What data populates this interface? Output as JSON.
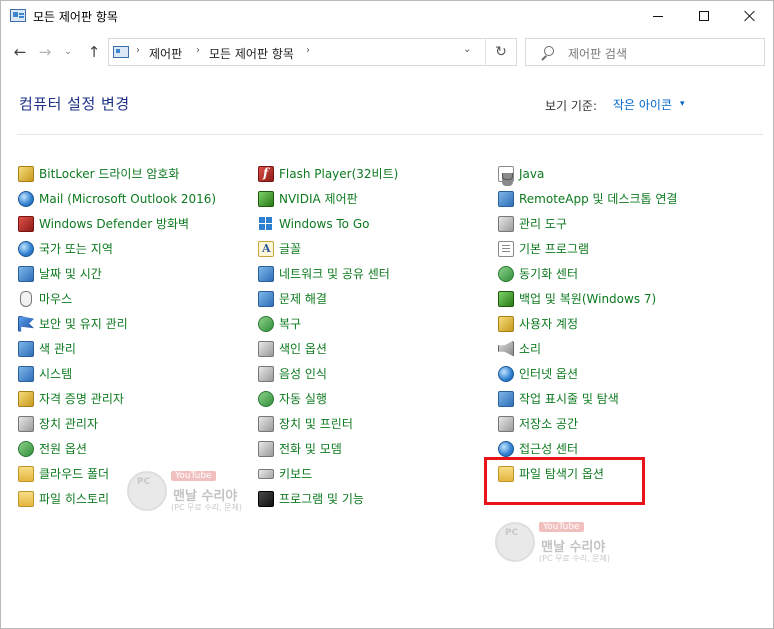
{
  "window": {
    "title": "모든 제어판 항목"
  },
  "nav": {
    "back_glyph": "←",
    "forward_glyph": "→",
    "recent_glyph": "⌄",
    "up_glyph": "↑",
    "breadcrumb": [
      "제어판",
      "모든 제어판 항목"
    ],
    "crumb_separator": "›",
    "dropdown_glyph": "⌄",
    "refresh_glyph": "↻",
    "search_placeholder": "제어판 검색"
  },
  "header": {
    "title": "컴퓨터 설정 변경",
    "view_label": "보기 기준:",
    "view_value": "작은 아이콘",
    "view_caret": "▾"
  },
  "columns": [
    [
      {
        "label": "BitLocker 드라이브 암호화",
        "icon": "bitlocker-icon"
      },
      {
        "label": "Mail (Microsoft Outlook 2016)",
        "icon": "mail-icon"
      },
      {
        "label": "Windows Defender 방화벽",
        "icon": "firewall-icon"
      },
      {
        "label": "국가 또는 지역",
        "icon": "region-globe-icon"
      },
      {
        "label": "날짜 및 시간",
        "icon": "date-time-icon"
      },
      {
        "label": "마우스",
        "icon": "mouse-icon"
      },
      {
        "label": "보안 및 유지 관리",
        "icon": "security-flag-icon"
      },
      {
        "label": "색 관리",
        "icon": "color-management-icon"
      },
      {
        "label": "시스템",
        "icon": "system-icon"
      },
      {
        "label": "자격 증명 관리자",
        "icon": "credential-manager-icon"
      },
      {
        "label": "장치 관리자",
        "icon": "device-manager-icon"
      },
      {
        "label": "전원 옵션",
        "icon": "power-options-icon"
      },
      {
        "label": "클라우드 폴더",
        "icon": "cloud-folder-icon"
      },
      {
        "label": "파일 히스토리",
        "icon": "file-history-icon"
      }
    ],
    [
      {
        "label": "Flash Player(32비트)",
        "icon": "flash-player-icon"
      },
      {
        "label": "NVIDIA 제어판",
        "icon": "nvidia-icon"
      },
      {
        "label": "Windows To Go",
        "icon": "windows-to-go-icon"
      },
      {
        "label": "글꼴",
        "icon": "fonts-icon"
      },
      {
        "label": "네트워크 및 공유 센터",
        "icon": "network-icon"
      },
      {
        "label": "문제 해결",
        "icon": "troubleshoot-icon"
      },
      {
        "label": "복구",
        "icon": "recovery-icon"
      },
      {
        "label": "색인 옵션",
        "icon": "indexing-icon"
      },
      {
        "label": "음성 인식",
        "icon": "speech-recognition-icon"
      },
      {
        "label": "자동 실행",
        "icon": "autoplay-icon"
      },
      {
        "label": "장치 및 프린터",
        "icon": "devices-printers-icon"
      },
      {
        "label": "전화 및 모뎀",
        "icon": "phone-modem-icon"
      },
      {
        "label": "키보드",
        "icon": "keyboard-icon"
      },
      {
        "label": "프로그램 및 기능",
        "icon": "programs-features-icon"
      }
    ],
    [
      {
        "label": "Java",
        "icon": "java-icon"
      },
      {
        "label": "RemoteApp 및 데스크톱 연결",
        "icon": "remoteapp-icon"
      },
      {
        "label": "관리 도구",
        "icon": "admin-tools-icon"
      },
      {
        "label": "기본 프로그램",
        "icon": "default-programs-icon"
      },
      {
        "label": "동기화 센터",
        "icon": "sync-center-icon"
      },
      {
        "label": "백업 및 복원(Windows 7)",
        "icon": "backup-restore-icon"
      },
      {
        "label": "사용자 계정",
        "icon": "user-accounts-icon"
      },
      {
        "label": "소리",
        "icon": "sound-icon"
      },
      {
        "label": "인터넷 옵션",
        "icon": "internet-options-icon"
      },
      {
        "label": "작업 표시줄 및 탐색",
        "icon": "taskbar-icon"
      },
      {
        "label": "저장소 공간",
        "icon": "storage-spaces-icon"
      },
      {
        "label": "접근성 센터",
        "icon": "ease-of-access-icon"
      },
      {
        "label": "파일 탐색기 옵션",
        "icon": "file-explorer-options-icon"
      }
    ]
  ],
  "highlight_color": "#e8141a",
  "watermark": {
    "badge": "PC",
    "youtube": "YouTube",
    "name": "맨날 수리야",
    "subtitle": "(PC 무료 수리, 문제)"
  }
}
